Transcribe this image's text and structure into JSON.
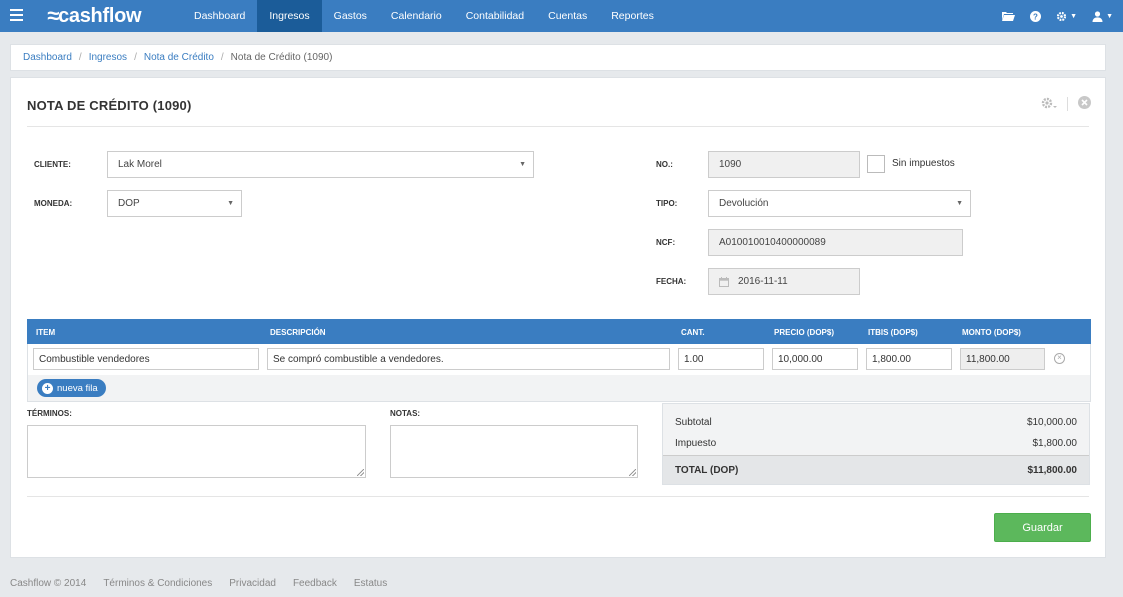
{
  "app": {
    "name": "cashflow",
    "nav": [
      "Dashboard",
      "Ingresos",
      "Gastos",
      "Calendario",
      "Contabilidad",
      "Cuentas",
      "Reportes"
    ],
    "active_nav": "Ingresos"
  },
  "breadcrumb": [
    "Dashboard",
    "Ingresos",
    "Nota de Crédito",
    "Nota de Crédito (1090)"
  ],
  "page": {
    "title": "NOTA DE CRÉDITO (1090)"
  },
  "form": {
    "cliente_label": "CLIENTE:",
    "cliente_value": "Lak Morel",
    "moneda_label": "MONEDA:",
    "moneda_value": "DOP",
    "no_label": "NO.:",
    "no_value": "1090",
    "sin_impuestos_label": "Sin impuestos",
    "tipo_label": "TIPO:",
    "tipo_value": "Devolución",
    "ncf_label": "NCF:",
    "ncf_value": "A010010010400000089",
    "fecha_label": "FECHA:",
    "fecha_value": "2016-11-11"
  },
  "table": {
    "headers": [
      "ITEM",
      "DESCRIPCIÓN",
      "CANT.",
      "PRECIO (DOP$)",
      "ITBIS (DOP$)",
      "MONTO (DOP$)"
    ],
    "rows": [
      {
        "item": "Combustible vendedores",
        "descripcion": "Se compró combustible a vendedores.",
        "cant": "1.00",
        "precio": "10,000.00",
        "itbis": "1,800.00",
        "monto": "11,800.00"
      }
    ],
    "add_row_label": "nueva fila"
  },
  "terminos_label": "TÉRMINOS:",
  "notas_label": "NOTAS:",
  "totals": {
    "subtotal_label": "Subtotal",
    "subtotal_value": "$10,000.00",
    "impuesto_label": "Impuesto",
    "impuesto_value": "$1,800.00",
    "total_label": "TOTAL (DOP)",
    "total_value": "$11,800.00"
  },
  "save_label": "Guardar",
  "footer": [
    "Cashflow © 2014",
    "Términos & Condiciones",
    "Privacidad",
    "Feedback",
    "Estatus"
  ]
}
